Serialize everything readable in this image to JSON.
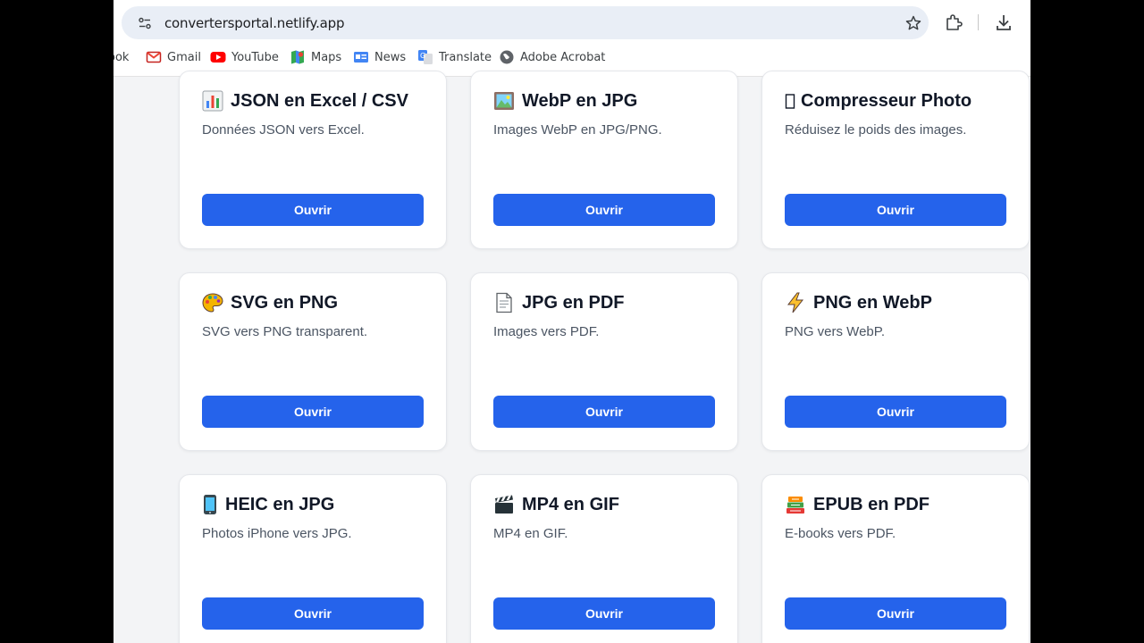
{
  "browser": {
    "url": "convertersportal.netlify.app",
    "bookmarks": [
      {
        "label": "ook",
        "icon": "facebook-icon"
      },
      {
        "label": "Gmail",
        "icon": "gmail-icon"
      },
      {
        "label": "YouTube",
        "icon": "youtube-icon"
      },
      {
        "label": "Maps",
        "icon": "maps-icon"
      },
      {
        "label": "News",
        "icon": "news-icon"
      },
      {
        "label": "Translate",
        "icon": "translate-icon"
      },
      {
        "label": "Adobe Acrobat",
        "icon": "globe-icon"
      }
    ]
  },
  "cards": [
    {
      "title": "JSON en Excel / CSV",
      "desc": "Données JSON vers Excel.",
      "button": "Ouvrir",
      "icon": "bar-chart-icon"
    },
    {
      "title": "WebP en JPG",
      "desc": "Images WebP en JPG/PNG.",
      "button": "Ouvrir",
      "icon": "picture-icon"
    },
    {
      "title": "Compresseur Photo",
      "desc": "Réduisez le poids des images.",
      "button": "Ouvrir",
      "icon": "missing-glyph-icon"
    },
    {
      "title": "SVG en PNG",
      "desc": "SVG vers PNG transparent.",
      "button": "Ouvrir",
      "icon": "palette-icon"
    },
    {
      "title": "JPG en PDF",
      "desc": "Images vers PDF.",
      "button": "Ouvrir",
      "icon": "document-icon"
    },
    {
      "title": "PNG en WebP",
      "desc": "PNG vers WebP.",
      "button": "Ouvrir",
      "icon": "lightning-icon"
    },
    {
      "title": "HEIC en JPG",
      "desc": "Photos iPhone vers JPG.",
      "button": "Ouvrir",
      "icon": "phone-icon"
    },
    {
      "title": "MP4 en GIF",
      "desc": "MP4 en GIF.",
      "button": "Ouvrir",
      "icon": "clapper-icon"
    },
    {
      "title": "EPUB en PDF",
      "desc": "E-books vers PDF.",
      "button": "Ouvrir",
      "icon": "books-icon"
    }
  ],
  "colors": {
    "accent": "#2563eb",
    "page_bg": "#f3f4f6",
    "card_bg": "#ffffff"
  }
}
